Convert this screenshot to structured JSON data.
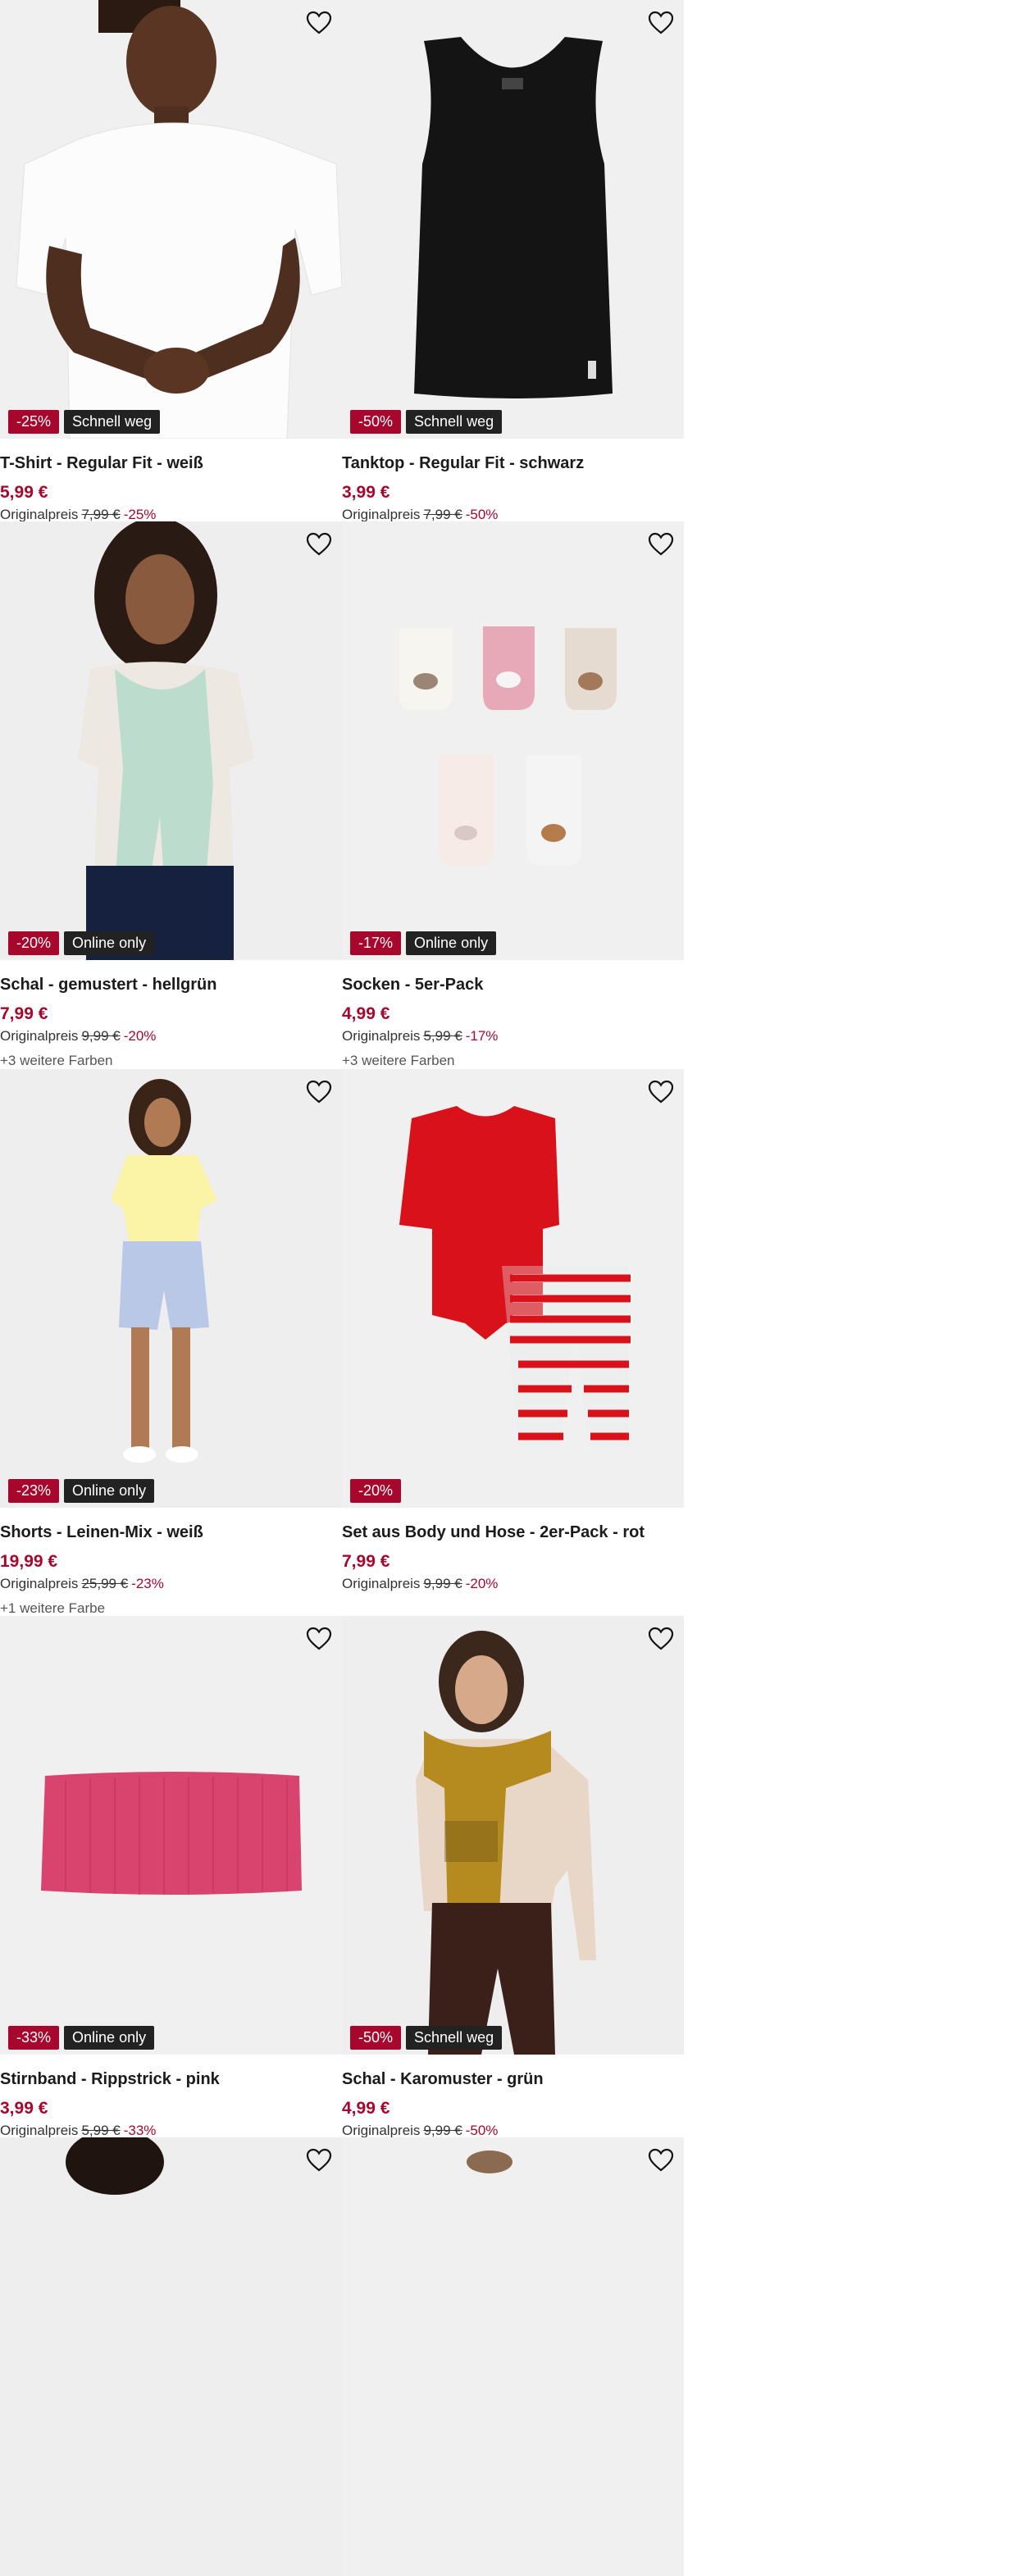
{
  "colors": {
    "accent": "#a8072d",
    "tag_bg": "#222222",
    "image_bg": "#f1f1f1"
  },
  "products": [
    {
      "name": "T-Shirt - Regular Fit - weiß",
      "price": "5,99 €",
      "orig_label": "Originalpreis",
      "orig_price": "7,99 €",
      "orig_pct": "-25%",
      "badge_discount": "-25%",
      "badge_tag": "Schnell weg",
      "colors": "",
      "image": "man-white-tshirt"
    },
    {
      "name": "Tanktop - Regular Fit - schwarz",
      "price": "3,99 €",
      "orig_label": "Originalpreis",
      "orig_price": "7,99 €",
      "orig_pct": "-50%",
      "badge_discount": "-50%",
      "badge_tag": "Schnell weg",
      "colors": "",
      "image": "black-tanktop"
    },
    {
      "name": "Schal - gemustert - hellgrün",
      "price": "7,99 €",
      "orig_label": "Originalpreis",
      "orig_price": "9,99 €",
      "orig_pct": "-20%",
      "badge_discount": "-20%",
      "badge_tag": "Online only",
      "colors": "+3 weitere Farben",
      "image": "woman-green-scarf"
    },
    {
      "name": "Socken - 5er-Pack",
      "price": "4,99 €",
      "orig_label": "Originalpreis",
      "orig_price": "5,99 €",
      "orig_pct": "-17%",
      "badge_discount": "-17%",
      "badge_tag": "Online only",
      "colors": "+3 weitere Farben",
      "image": "baby-socks"
    },
    {
      "name": "Shorts - Leinen-Mix - weiß",
      "price": "19,99 €",
      "orig_label": "Originalpreis",
      "orig_price": "25,99 €",
      "orig_pct": "-23%",
      "badge_discount": "-23%",
      "badge_tag": "Online only",
      "colors": "+1 weitere Farbe",
      "image": "woman-shorts"
    },
    {
      "name": "Set aus Body und Hose - 2er-Pack - rot",
      "price": "7,99 €",
      "orig_label": "Originalpreis",
      "orig_price": "9,99 €",
      "orig_pct": "-20%",
      "badge_discount": "-20%",
      "badge_tag": "",
      "colors": "",
      "image": "baby-body-set"
    },
    {
      "name": "Stirnband - Rippstrick - pink",
      "price": "3,99 €",
      "orig_label": "Originalpreis",
      "orig_price": "5,99 €",
      "orig_pct": "-33%",
      "badge_discount": "-33%",
      "badge_tag": "Online only",
      "colors": "",
      "image": "pink-headband"
    },
    {
      "name": "Schal - Karomuster - grün",
      "price": "4,99 €",
      "orig_label": "Originalpreis",
      "orig_price": "9,99 €",
      "orig_pct": "-50%",
      "badge_discount": "-50%",
      "badge_tag": "Schnell weg",
      "colors": "",
      "image": "woman-check-scarf"
    }
  ]
}
